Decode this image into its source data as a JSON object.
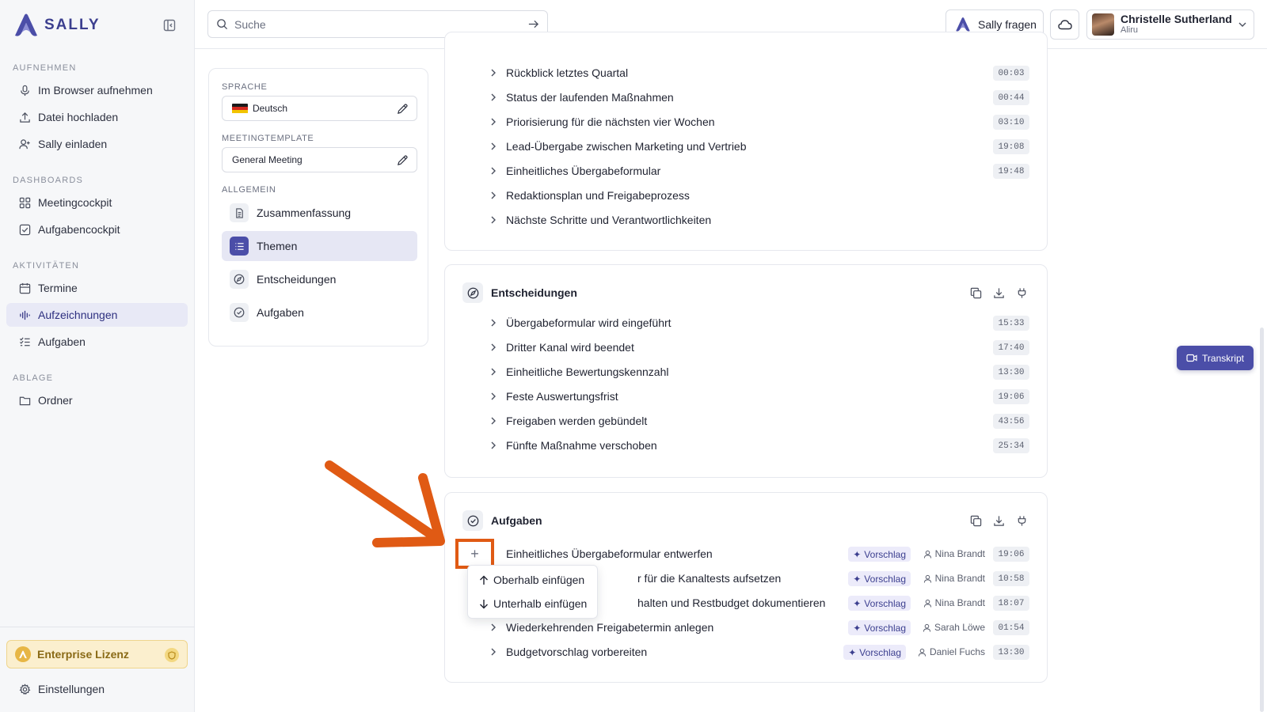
{
  "brand": {
    "name": "SALLY"
  },
  "sidebar": {
    "sections": [
      {
        "label": "AUFNEHMEN",
        "items": [
          {
            "label": "Im Browser aufnehmen",
            "icon": "mic-icon"
          },
          {
            "label": "Datei hochladen",
            "icon": "upload-icon"
          },
          {
            "label": "Sally einladen",
            "icon": "user-plus-icon"
          }
        ]
      },
      {
        "label": "DASHBOARDS",
        "items": [
          {
            "label": "Meetingcockpit",
            "icon": "grid-icon"
          },
          {
            "label": "Aufgabencockpit",
            "icon": "checkbox-icon"
          }
        ]
      },
      {
        "label": "AKTIVITÄTEN",
        "items": [
          {
            "label": "Termine",
            "icon": "calendar-icon"
          },
          {
            "label": "Aufzeichnungen",
            "icon": "waveform-icon",
            "active": true
          },
          {
            "label": "Aufgaben",
            "icon": "checklist-icon"
          }
        ]
      },
      {
        "label": "ABLAGE",
        "items": [
          {
            "label": "Ordner",
            "icon": "folder-icon"
          }
        ]
      }
    ],
    "license_label": "Enterprise Lizenz",
    "settings_label": "Einstellungen"
  },
  "topbar": {
    "search_placeholder": "Suche",
    "ask_label": "Sally fragen",
    "user_name": "Christelle Sutherland",
    "user_org": "Aliru"
  },
  "settings_panel": {
    "language_label": "SPRACHE",
    "language_value": "Deutsch",
    "template_label": "MEETINGTEMPLATE",
    "template_value": "General Meeting",
    "general_label": "ALLGEMEIN",
    "items": [
      {
        "label": "Zusammenfassung",
        "icon": "document-icon"
      },
      {
        "label": "Themen",
        "icon": "list-icon",
        "active": true
      },
      {
        "label": "Entscheidungen",
        "icon": "compass-icon"
      },
      {
        "label": "Aufgaben",
        "icon": "check-circle-icon"
      }
    ]
  },
  "topics": {
    "rows": [
      {
        "title": "Rückblick letztes Quartal",
        "time": "00:03"
      },
      {
        "title": "Status der laufenden Maßnahmen",
        "time": "00:44"
      },
      {
        "title": "Priorisierung für die nächsten vier Wochen",
        "time": "03:10"
      },
      {
        "title": "Lead-Übergabe zwischen Marketing und Vertrieb",
        "time": "19:08"
      },
      {
        "title": "Einheitliches Übergabeformular",
        "time": "19:48"
      },
      {
        "title": "Redaktionsplan und Freigabeprozess",
        "time": ""
      },
      {
        "title": "Nächste Schritte und Verantwortlichkeiten",
        "time": ""
      }
    ]
  },
  "decisions": {
    "title": "Entscheidungen",
    "rows": [
      {
        "title": "Übergabeformular wird eingeführt",
        "time": "15:33"
      },
      {
        "title": "Dritter Kanal wird beendet",
        "time": "17:40"
      },
      {
        "title": "Einheitliche Bewertungskennzahl",
        "time": "13:30"
      },
      {
        "title": "Feste Auswertungsfrist",
        "time": "19:06"
      },
      {
        "title": "Freigaben werden gebündelt",
        "time": "43:56"
      },
      {
        "title": "Fünfte Maßnahme verschoben",
        "time": "25:34"
      }
    ]
  },
  "tasks": {
    "title": "Aufgaben",
    "badge_label": "Vorschlag",
    "rows": [
      {
        "title": "Einheitliches Übergabeformular entwerfen",
        "assignee": "Nina Brandt",
        "time": "19:06"
      },
      {
        "title": "r für die Kanaltests aufsetzen",
        "assignee": "Nina Brandt",
        "time": "10:58"
      },
      {
        "title": "halten und Restbudget dokumentieren",
        "assignee": "Nina Brandt",
        "time": "18:07"
      },
      {
        "title": "Wiederkehrenden Freigabetermin anlegen",
        "assignee": "Sarah Löwe",
        "time": "01:54"
      },
      {
        "title": "Budgetvorschlag vorbereiten",
        "assignee": "Daniel Fuchs",
        "time": "13:30"
      }
    ]
  },
  "insert_menu": {
    "plus": "+",
    "above": "Oberhalb einfügen",
    "below": "Unterhalb einfügen"
  },
  "transcript_label": "Transkript",
  "colors": {
    "accent": "#4b4ea8",
    "annotation": "#e05a14",
    "license_bg": "#fbefce"
  }
}
